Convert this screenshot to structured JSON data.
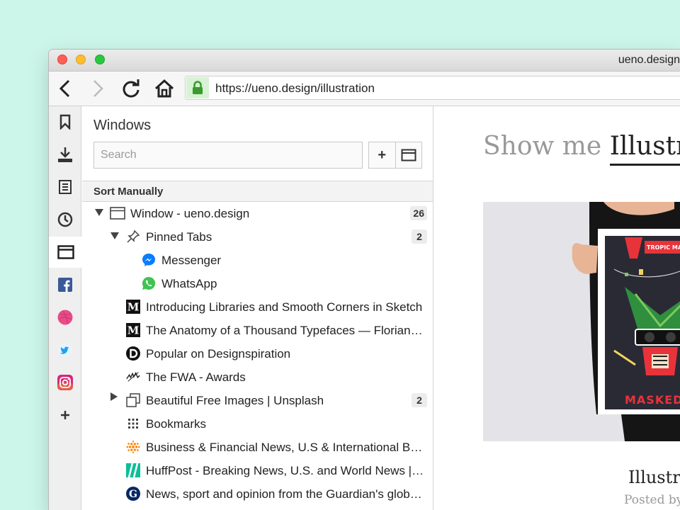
{
  "window": {
    "title": "ueno.design"
  },
  "nav": {
    "url": "https://ueno.design/illustration"
  },
  "panel": {
    "title": "Windows",
    "search_placeholder": "Search",
    "add_label": "+",
    "sort_label": "Sort Manually"
  },
  "tree": [
    {
      "label": "Window - ueno.design",
      "count": "26",
      "icon": "window-icon"
    },
    {
      "label": "Pinned Tabs",
      "count": "2",
      "icon": "pin-icon"
    },
    {
      "label": "Messenger",
      "icon": "messenger-icon"
    },
    {
      "label": "WhatsApp",
      "icon": "whatsapp-icon"
    },
    {
      "label": "Introducing Libraries and Smooth Corners in Sketch",
      "icon": "medium-icon"
    },
    {
      "label": "The Anatomy of a Thousand Typefaces — Florian Schulz",
      "icon": "medium-icon"
    },
    {
      "label": "Popular on Designspiration",
      "icon": "designspiration-icon"
    },
    {
      "label": "The FWA - Awards",
      "icon": "fwa-icon"
    },
    {
      "label": "Beautiful Free Images | Unsplash",
      "count": "2",
      "icon": "tab-stack-icon"
    },
    {
      "label": "Bookmarks",
      "icon": "bookmarks-grid-icon"
    },
    {
      "label": "Business & Financial News, U.S & International Breaking News",
      "icon": "reuters-icon"
    },
    {
      "label": "HuffPost - Breaking News, U.S. and World News | HuffPost",
      "icon": "huffpost-icon"
    },
    {
      "label": "News, sport and opinion from the Guardian's global edition",
      "icon": "guardian-icon"
    }
  ],
  "content": {
    "heading_prefix": "Show me",
    "heading_selected": "Illustrat",
    "article_title": "Illustra",
    "posted_by": "Posted by",
    "poster_text_top": "TROPIC MASSUS",
    "poster_text_bottom": "MASKED V"
  },
  "colors": {
    "background": "#cdf6ea",
    "lock_green": "#3a9a2c",
    "poster_red": "#e8333a",
    "poster_dark": "#2a2a35"
  }
}
